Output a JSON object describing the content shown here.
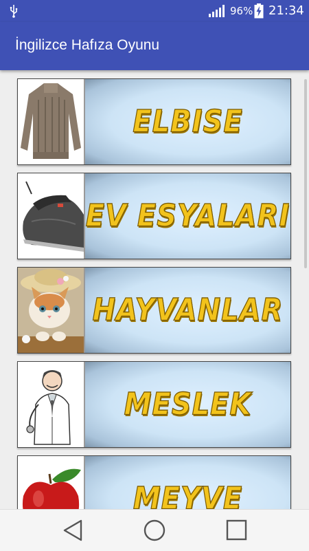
{
  "status_bar": {
    "battery_percent": "96%",
    "time": "21:34",
    "icons": [
      "usb-icon",
      "signal-icon",
      "battery-charging-icon"
    ]
  },
  "app_bar": {
    "title": "İngilizce Hafıza Oyunu"
  },
  "categories": [
    {
      "label": "ELBISE",
      "icon": "sweater-image"
    },
    {
      "label": "EV ESYALARI",
      "icon": "iron-image"
    },
    {
      "label": "HAYVANLAR",
      "icon": "kitten-image"
    },
    {
      "label": "MESLEK",
      "icon": "doctor-image"
    },
    {
      "label": "MEYVE",
      "icon": "apple-image"
    }
  ],
  "nav_bar": {
    "icons": [
      "back-icon",
      "home-icon",
      "recent-apps-icon"
    ]
  },
  "colors": {
    "primary": "#3f51b5",
    "label_yellow": "#f2c31c",
    "label_background": "#cde4f6"
  }
}
